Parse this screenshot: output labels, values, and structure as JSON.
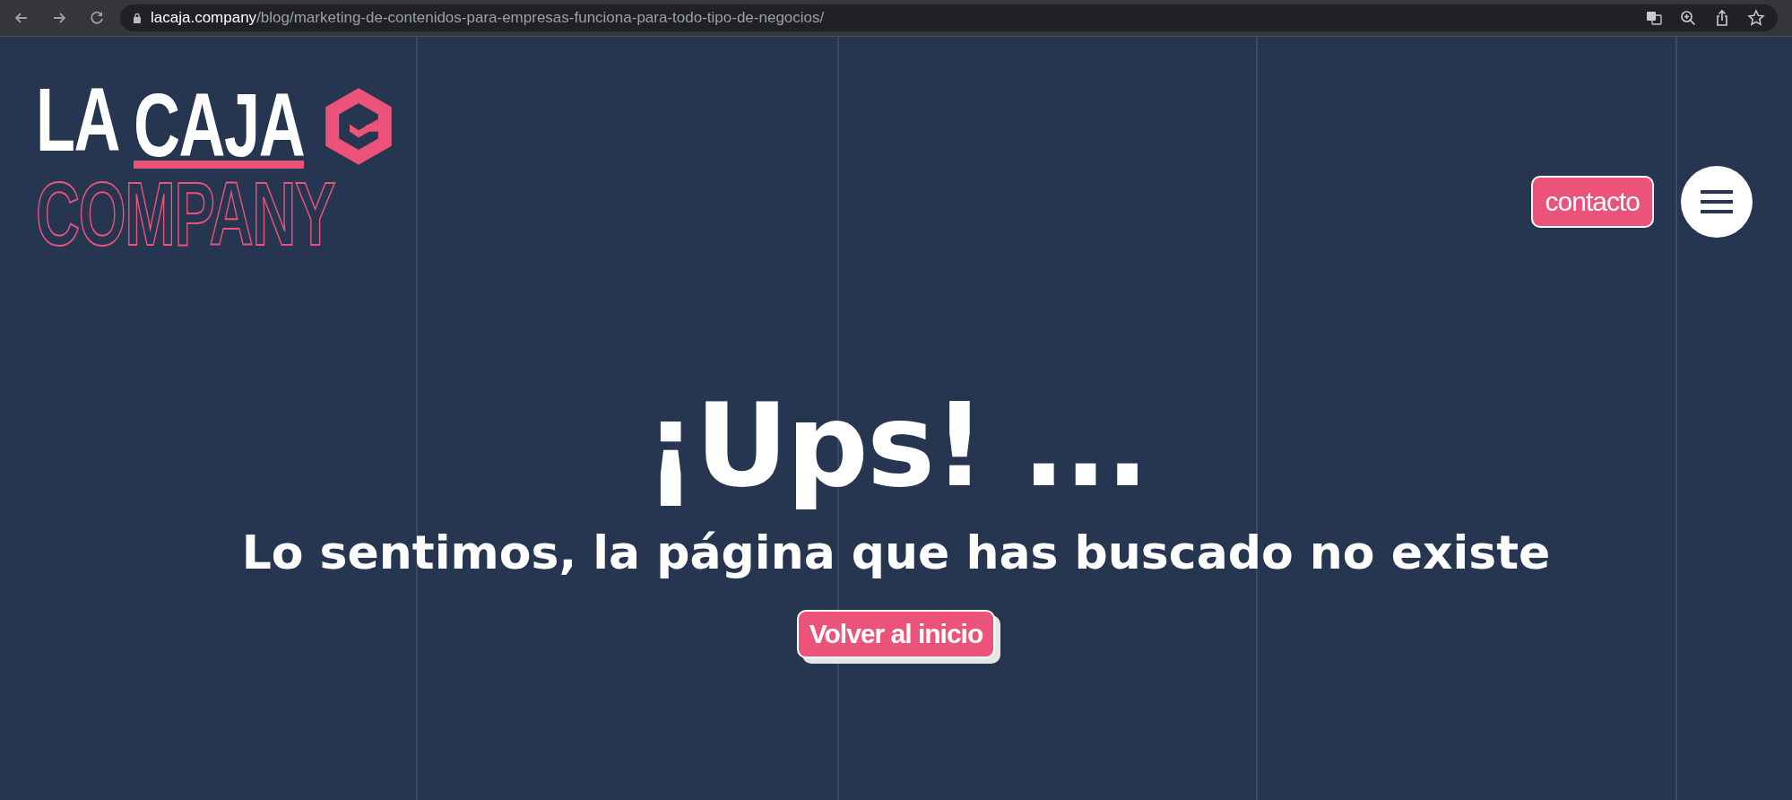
{
  "browser": {
    "url_host": "lacaja.company",
    "url_path": "/blog/marketing-de-contenidos-para-empresas-funciona-para-todo-tipo-de-negocios/"
  },
  "logo": {
    "line_1_left": "LA",
    "line_1_right": "CAJA",
    "line_2": "COMPANY"
  },
  "header": {
    "contact_button": "contacto"
  },
  "error": {
    "title": "¡Ups! ...",
    "message": "Lo sentimos, la página que has buscado no existe",
    "button": "Volver al inicio"
  }
}
